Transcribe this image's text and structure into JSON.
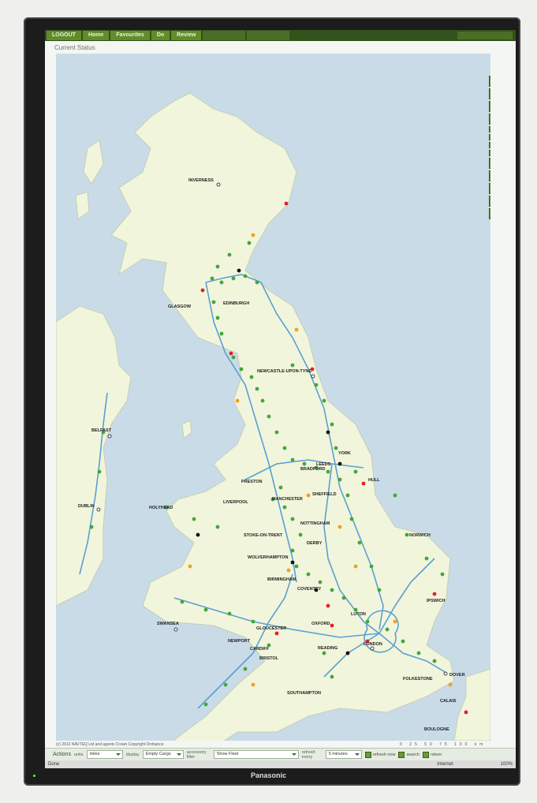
{
  "nav": {
    "items": [
      "LOGOUT",
      "Home",
      "Favourites",
      "Do",
      "Review"
    ]
  },
  "page": {
    "title": "Current Status"
  },
  "map": {
    "cities": [
      "INVERNESS",
      "GLASGOW",
      "EDINBURGH",
      "NEWCASTLE-UPON-TYNE",
      "BELFAST",
      "YORK",
      "LEEDS",
      "BRADFORD",
      "HULL",
      "PRESTON",
      "SHEFFIELD",
      "LIVERPOOL",
      "MANCHESTER",
      "HOLYHEAD",
      "DUBLIN",
      "NOTTINGHAM",
      "STOKE-ON-TRENT",
      "DERBY",
      "NORWICH",
      "WOLVERHAMPTON",
      "BIRMINGHAM",
      "COVENTRY",
      "IPSWICH",
      "LUTON",
      "SWANSEA",
      "GLOUCESTER",
      "OXFORD",
      "NEWPORT",
      "CARDIFF",
      "BRISTOL",
      "READING",
      "LONDON",
      "FOLKESTONE",
      "DOVER",
      "CALAIS",
      "SOUTHAMPTON",
      "BOULOGNE"
    ],
    "colors": {
      "sea": "#c9dbe7",
      "land": "#f1f5dc",
      "road": "#5aa0d0",
      "ok": "#43a63c",
      "warn": "#f0a020",
      "bad": "#e0202a",
      "closed": "#111111"
    }
  },
  "footer": {
    "copyright": "(c) 2012 NAVTEQ Ltd and agents Crown Copyright Ordnance",
    "scale": "0 25 50 75 100 km",
    "actions_label": "Actions",
    "units_label": "units",
    "units_value": "miles",
    "display_label": "display",
    "display_value": "Empty Cargo",
    "filter_label": "accessory filter",
    "filter_value": "Show Fleet",
    "refresh_label": "refresh every",
    "refresh_value": "5 minutes",
    "refresh_now": "refresh now",
    "search": "search",
    "return": "return"
  },
  "browser": {
    "status": "Done",
    "zone": "Internet",
    "zoom": "100%"
  },
  "device": {
    "brand": "Panasonic"
  }
}
